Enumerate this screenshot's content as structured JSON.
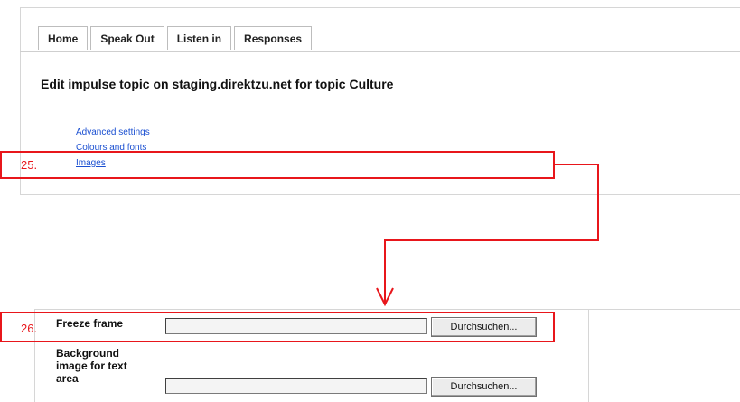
{
  "tabs": [
    {
      "label": "Home"
    },
    {
      "label": "Speak Out"
    },
    {
      "label": "Listen in"
    },
    {
      "label": "Responses"
    }
  ],
  "page_title": "Edit impulse topic on staging.direktzu.net for topic Culture",
  "links": [
    {
      "label": "Advanced settings"
    },
    {
      "label": "Colours and fonts"
    },
    {
      "label": "Images"
    }
  ],
  "annotations": [
    {
      "number": "25."
    },
    {
      "number": "26."
    }
  ],
  "form": {
    "freeze_frame_label": "Freeze frame",
    "background_label": "Background image for text area",
    "browse_label": "Durchsuchen..."
  },
  "colors": {
    "annotation": "#e8161b",
    "link": "#1a4fd1"
  }
}
